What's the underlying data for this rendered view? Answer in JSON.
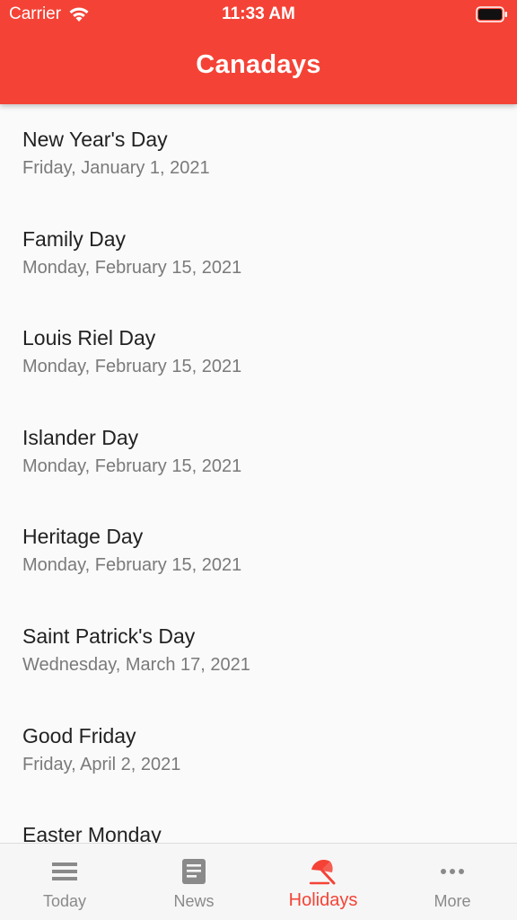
{
  "status_bar": {
    "carrier": "Carrier",
    "time": "11:33 AM"
  },
  "header": {
    "title": "Canadays",
    "color": "#f44336"
  },
  "holidays": [
    {
      "name": "New Year's Day",
      "date": "Friday, January 1, 2021"
    },
    {
      "name": "Family Day",
      "date": "Monday, February 15, 2021"
    },
    {
      "name": "Louis Riel Day",
      "date": "Monday, February 15, 2021"
    },
    {
      "name": "Islander Day",
      "date": "Monday, February 15, 2021"
    },
    {
      "name": "Heritage Day",
      "date": "Monday, February 15, 2021"
    },
    {
      "name": "Saint Patrick's Day",
      "date": "Wednesday, March 17, 2021"
    },
    {
      "name": "Good Friday",
      "date": "Friday, April 2, 2021"
    },
    {
      "name": "Easter Monday",
      "date": ""
    }
  ],
  "tabs": [
    {
      "label": "Today",
      "icon": "menu-lines-icon",
      "active": false
    },
    {
      "label": "News",
      "icon": "article-icon",
      "active": false
    },
    {
      "label": "Holidays",
      "icon": "beach-umbrella-icon",
      "active": true
    },
    {
      "label": "More",
      "icon": "more-dots-icon",
      "active": false
    }
  ],
  "colors": {
    "accent": "#f44336",
    "inactive_tab": "#8a8a8a",
    "secondary_text": "#7a7a7a"
  }
}
